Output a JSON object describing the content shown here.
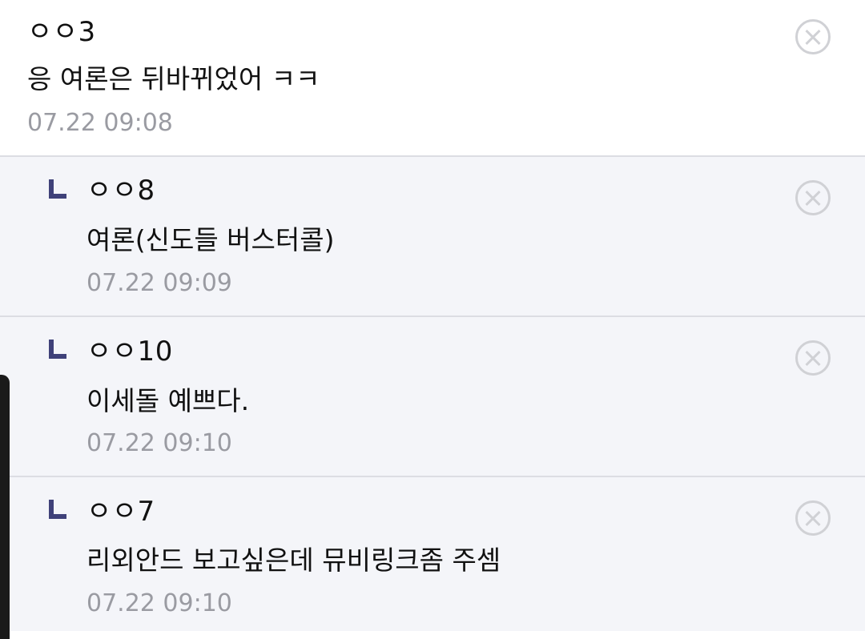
{
  "comments": [
    {
      "author": "ㅇㅇ3",
      "text": "응 여론은 뒤바뀌었어 ㅋㅋ",
      "time": "07.22 09:08",
      "is_reply": false
    },
    {
      "author": "ㅇㅇ8",
      "text": "여론(신도들 버스터콜)",
      "time": "07.22 09:09",
      "is_reply": true
    },
    {
      "author": "ㅇㅇ10",
      "text": "이세돌 예쁘다.",
      "time": "07.22 09:10",
      "is_reply": true
    },
    {
      "author": "ㅇㅇ7",
      "text": "리외안드 보고싶은데 뮤비링크좀 주셈",
      "time": "07.22 09:10",
      "is_reply": true
    }
  ],
  "icons": {
    "delete": "close-circle-icon",
    "reply_marker": "reply-arrow-icon"
  },
  "colors": {
    "reply_background": "#f4f5f9",
    "reply_marker": "#3f4179",
    "timestamp": "#9a9ba2",
    "divider": "#dcdde3"
  }
}
